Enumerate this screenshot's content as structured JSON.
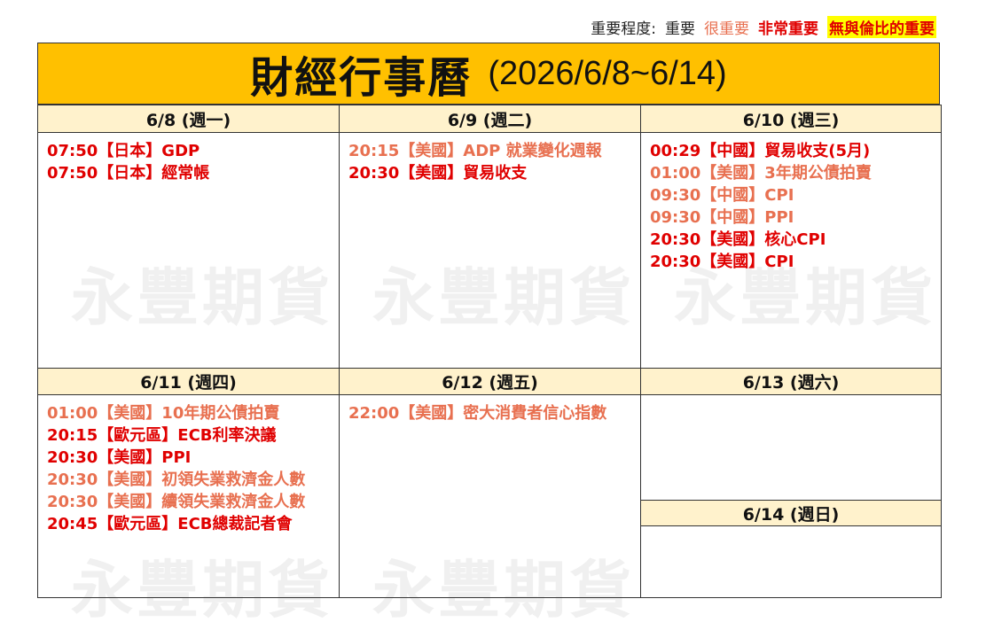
{
  "legend": {
    "label": "重要程度:",
    "normal": "重要",
    "very": "很重要",
    "extreme": "非常重要",
    "max": "無與倫比的重要"
  },
  "watermark": "永豐期貨",
  "title": {
    "main": "財經行事曆",
    "range": "(2026/6/8~6/14)",
    "background": "#ffc000"
  },
  "colors": {
    "very_important": "#e87050",
    "extremely_important": "#e00000",
    "header_bg": "#fff2cc"
  },
  "days": [
    {
      "header": "6/8 (週一)",
      "events": [
        {
          "text": "07:50【日本】GDP",
          "level": 3
        },
        {
          "text": "07:50【日本】經常帳",
          "level": 3
        }
      ]
    },
    {
      "header": "6/9 (週二)",
      "events": [
        {
          "text": "20:15【美國】ADP 就業變化週報",
          "level": 2
        },
        {
          "text": "20:30【美國】貿易收支",
          "level": 3
        }
      ]
    },
    {
      "header": "6/10 (週三)",
      "events": [
        {
          "text": "00:29【中國】貿易收支(5月)",
          "level": 3
        },
        {
          "text": "01:00【美國】3年期公債拍賣",
          "level": 2
        },
        {
          "text": "09:30【中國】CPI",
          "level": 2
        },
        {
          "text": "09:30【中國】PPI",
          "level": 2
        },
        {
          "text": "20:30【美國】核心CPI",
          "level": 3
        },
        {
          "text": "20:30【美國】CPI",
          "level": 3
        }
      ]
    },
    {
      "header": "6/11 (週四)",
      "events": [
        {
          "text": "01:00【美國】10年期公債拍賣",
          "level": 2
        },
        {
          "text": "20:15【歐元區】ECB利率決議",
          "level": 3
        },
        {
          "text": "20:30【美國】PPI",
          "level": 3
        },
        {
          "text": "20:30【美國】初領失業救濟金人數",
          "level": 2
        },
        {
          "text": "20:30【美國】續領失業救濟金人數",
          "level": 2
        },
        {
          "text": "20:45【歐元區】ECB總裁記者會",
          "level": 3
        }
      ]
    },
    {
      "header": "6/12 (週五)",
      "events": [
        {
          "text": "22:00【美國】密大消費者信心指數",
          "level": 2
        }
      ]
    },
    {
      "header": "6/13 (週六)",
      "events": []
    },
    {
      "header": "6/14 (週日)",
      "events": []
    }
  ]
}
